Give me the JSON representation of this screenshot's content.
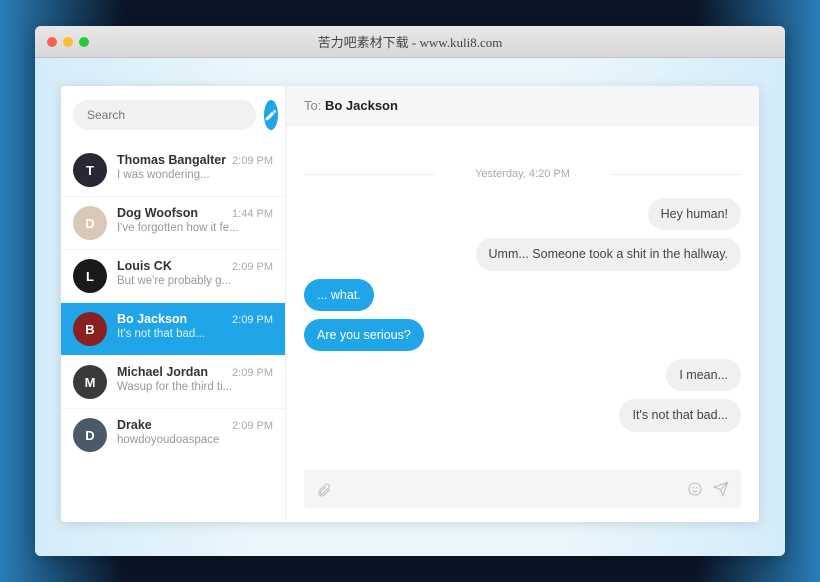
{
  "window": {
    "title": "苦力吧素材下载 - www.kuli8.com"
  },
  "search": {
    "placeholder": "Search"
  },
  "conversations": [
    {
      "name": "Thomas Bangalter",
      "time": "2:09 PM",
      "preview": "I was wondering...",
      "initial": "T",
      "active": false
    },
    {
      "name": "Dog Woofson",
      "time": "1:44 PM",
      "preview": "I've forgotten how it fe...",
      "initial": "D",
      "active": false
    },
    {
      "name": "Louis CK",
      "time": "2:09 PM",
      "preview": "But we're probably g...",
      "initial": "L",
      "active": false
    },
    {
      "name": "Bo Jackson",
      "time": "2:09 PM",
      "preview": "It's not that bad...",
      "initial": "B",
      "active": true
    },
    {
      "name": "Michael Jordan",
      "time": "2:09 PM",
      "preview": "Wasup for the third ti...",
      "initial": "M",
      "active": false
    },
    {
      "name": "Drake",
      "time": "2:09 PM",
      "preview": "howdoyoudoaspace",
      "initial": "D",
      "active": false
    }
  ],
  "chat": {
    "to_label": "To: ",
    "to_name": "Bo Jackson",
    "divider": "Yesterday, 4:20 PM",
    "messages": [
      {
        "dir": "in",
        "text": "Hey human!"
      },
      {
        "dir": "in",
        "text": "Umm... Someone took a shit in the hallway."
      },
      {
        "dir": "out",
        "text": "... what."
      },
      {
        "dir": "out",
        "text": "Are you serious?"
      },
      {
        "dir": "in",
        "text": "I mean..."
      },
      {
        "dir": "in",
        "text": "It's not that bad..."
      }
    ]
  }
}
